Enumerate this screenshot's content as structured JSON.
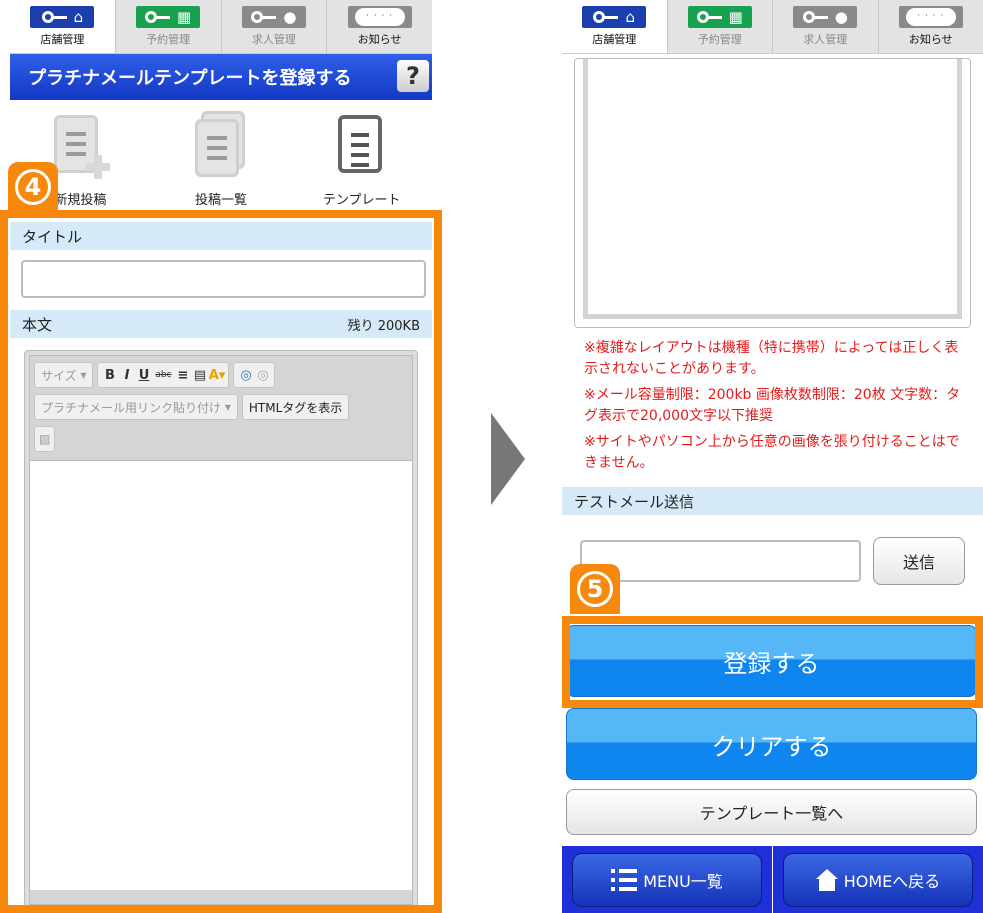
{
  "tabs": [
    {
      "label": "店舗管理",
      "icon": "key-shop-icon",
      "active": true
    },
    {
      "label": "予約管理",
      "icon": "key-calendar-icon",
      "active": false
    },
    {
      "label": "求人管理",
      "icon": "key-person-icon",
      "active": false
    },
    {
      "label": "お知らせ",
      "icon": "speech-bubble-icon",
      "active": false
    }
  ],
  "page": {
    "title": "プラチナメールテンプレートを登録する",
    "help_label": "?"
  },
  "icon_nav": [
    {
      "label": "新規投稿",
      "icon": "new-post-icon"
    },
    {
      "label": "投稿一覧",
      "icon": "post-list-icon"
    },
    {
      "label": "テンプレート",
      "icon": "template-icon"
    }
  ],
  "form": {
    "title_label": "タイトル",
    "title_value": "",
    "body_label": "本文",
    "remaining": "残り 200KB",
    "toolbar": {
      "size_label": "サイズ",
      "bold": "B",
      "italic": "I",
      "underline": "U",
      "strike": "abc",
      "link_label": "プラチナメール用リンク貼り付け",
      "html_label": "HTMLタグを表示"
    }
  },
  "notes": [
    "※複雑なレイアウトは機種（特に携帯）によっては正しく表示されないことがあります。",
    "※メール容量制限：200kb 画像枚数制限：20枚 文字数：タグ表示で20,000文字以下推奨",
    "※サイトやパソコン上から任意の画像を張り付けることはできません。"
  ],
  "test_mail": {
    "label": "テストメール送信",
    "value": "",
    "send_label": "送信"
  },
  "buttons": {
    "register": "登録する",
    "clear": "クリアする",
    "template_list": "テンプレート一覧へ"
  },
  "footer": {
    "menu_label": "MENU一覧",
    "home_label": "HOMEへ戻る"
  },
  "annotations": {
    "step4": "4",
    "step5": "5"
  },
  "colors": {
    "highlight": "#f7880c",
    "title_bar": "#1338c4",
    "notes_text": "#e41b1b",
    "primary_button": "#0f86ef"
  }
}
